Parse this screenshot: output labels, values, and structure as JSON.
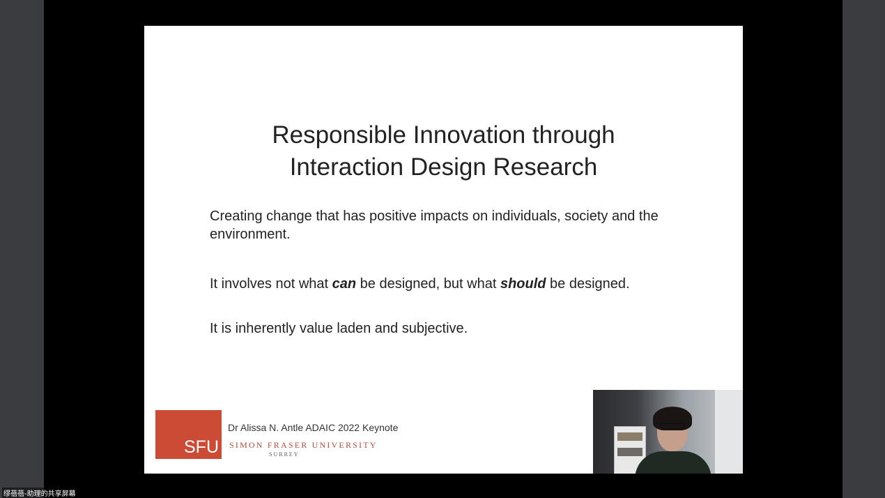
{
  "slide": {
    "title_line1": "Responsible Innovation through",
    "title_line2": "Interaction Design Research",
    "paragraph1": "Creating change that has positive impacts on individuals, society and the environment.",
    "paragraph2": {
      "part1": "It involves not what ",
      "emph1": "can",
      "part2": " be designed, but what ",
      "emph2": "should",
      "part3": " be designed."
    },
    "paragraph3": "It is inherently value laden and subjective.",
    "footer": {
      "logo_text": "SFU",
      "credit": "Dr Alissa N. Antle ADAIC 2022 Keynote",
      "university": "SIMON FRASER UNIVERSITY",
      "campus": "SURREY"
    }
  },
  "share_caption": "缪蓓蓓-助理的共享屏幕",
  "colors": {
    "logo_red": "#cc4b34",
    "university_text": "#b84a3a",
    "side_panel": "#3a3c3f"
  }
}
